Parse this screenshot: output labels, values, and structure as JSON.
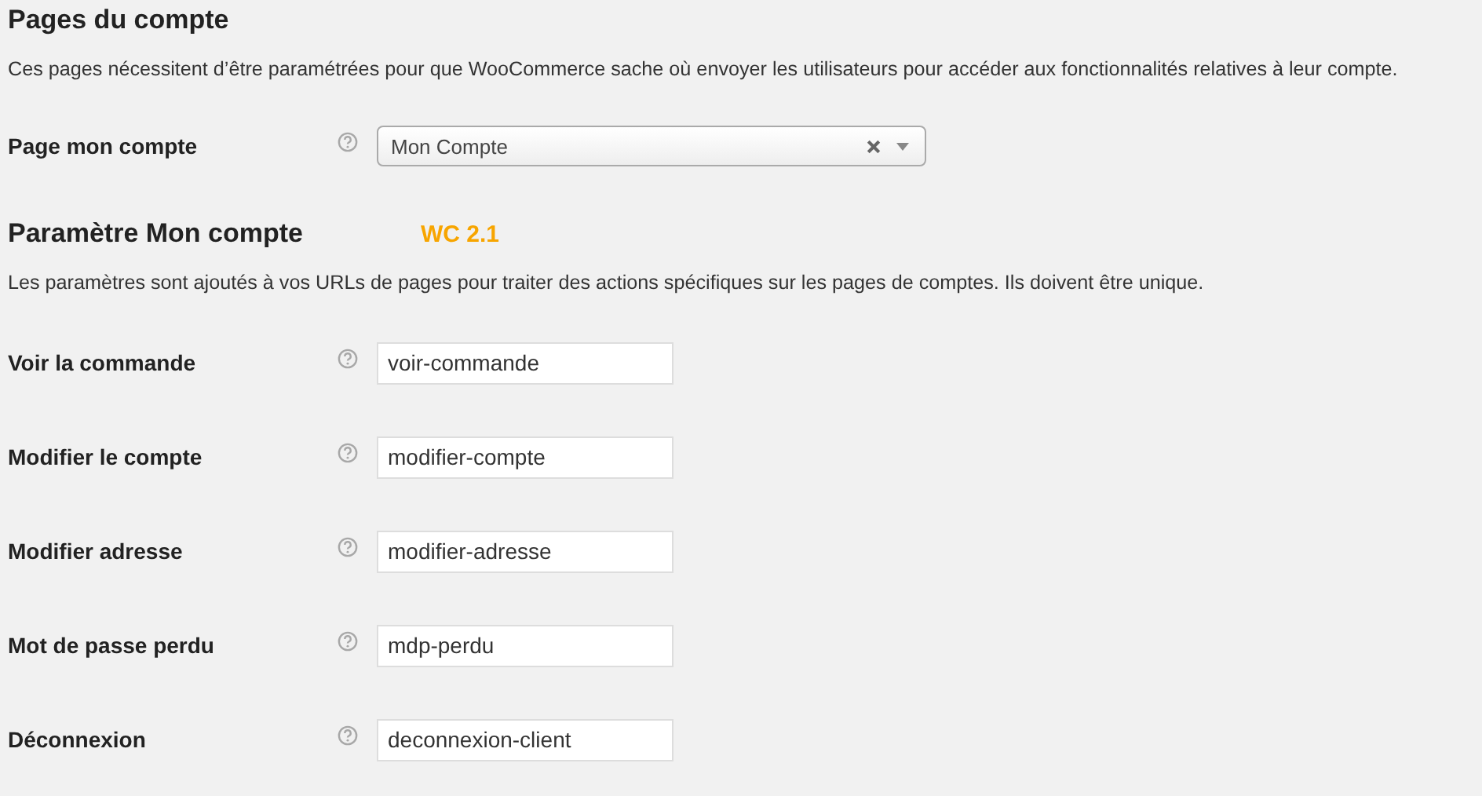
{
  "sections": [
    {
      "title": "Pages du compte",
      "description": "Ces pages nécessitent d’être paramétrées pour que WooCommerce sache où envoyer les utilisateurs pour accéder aux fonctionnalités relatives à leur compte.",
      "fields": [
        {
          "kind": "select",
          "label": "Page mon compte",
          "value": "Mon Compte"
        }
      ]
    },
    {
      "title": "Paramètre Mon compte",
      "badge": "WC 2.1",
      "description": "Les paramètres sont ajoutés à vos URLs de pages pour traiter des actions spécifiques sur les pages de comptes. Ils doivent être unique.",
      "fields": [
        {
          "kind": "text",
          "label": "Voir la commande",
          "value": "voir-commande"
        },
        {
          "kind": "text",
          "label": "Modifier le compte",
          "value": "modifier-compte"
        },
        {
          "kind": "text",
          "label": "Modifier adresse",
          "value": "modifier-adresse"
        },
        {
          "kind": "text",
          "label": "Mot de passe perdu",
          "value": "mdp-perdu"
        },
        {
          "kind": "text",
          "label": "Déconnexion",
          "value": "deconnexion-client"
        }
      ]
    }
  ]
}
